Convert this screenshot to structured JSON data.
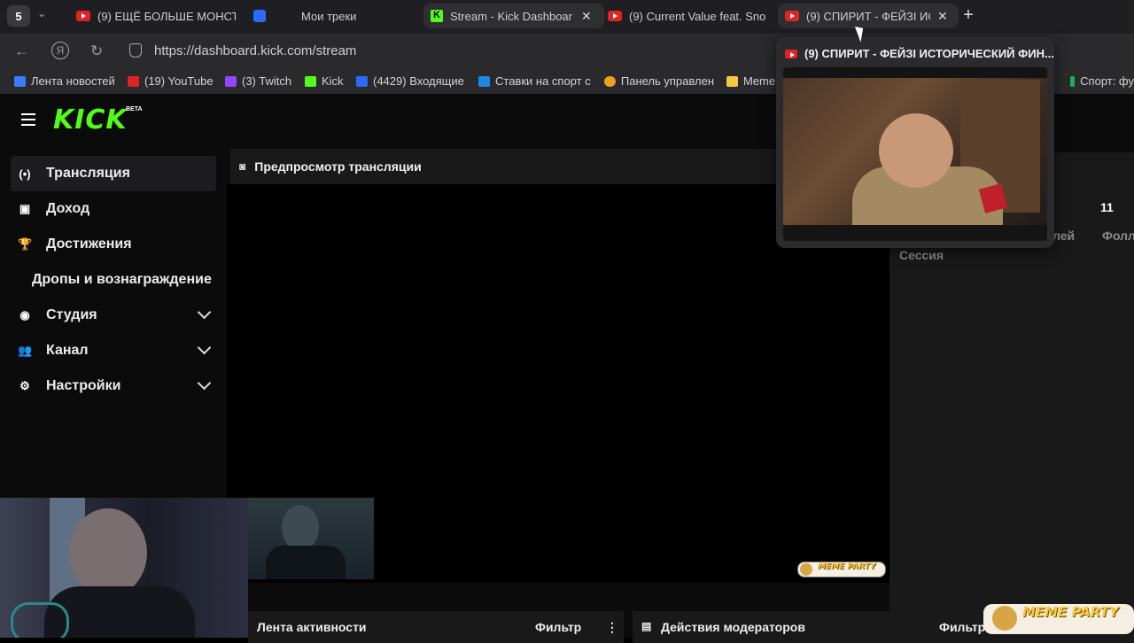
{
  "browser": {
    "tabs_count": "5",
    "tabs": [
      {
        "label": "(9) ЕЩЁ БОЛЬШЕ МОНСТ",
        "icon": "youtube-icon"
      },
      {
        "label": "Мои треки",
        "icon": "music-icon"
      },
      {
        "label": "Stream - Kick Dashboar",
        "icon": "kick-icon"
      },
      {
        "label": "(9) Current Value feat. Sno",
        "icon": "youtube-icon"
      },
      {
        "label": "(9) СПИРИТ - ФЕЙЗІ ИС",
        "icon": "youtube-icon"
      }
    ],
    "url": "https://dashboard.kick.com/stream",
    "bookmarks": [
      {
        "label": "Лента новостей"
      },
      {
        "label": "(19) YouTube"
      },
      {
        "label": "(3) Twitch"
      },
      {
        "label": "Kick"
      },
      {
        "label": "(4429) Входящие"
      },
      {
        "label": "Ставки на спорт с"
      },
      {
        "label": "Панель управлен"
      },
      {
        "label": "Meme"
      },
      {
        "label": "Спорт: фу"
      }
    ],
    "hover_preview_title": "(9) СПИРИТ - ФЕЙЗІ ИСТОРИЧЕСКИЙ ФИН..."
  },
  "kick": {
    "logo": "KICK",
    "beta": "BETA",
    "sidebar": [
      {
        "label": "Трансляция",
        "icon": "broadcast-icon"
      },
      {
        "label": "Доход",
        "icon": "chart-icon"
      },
      {
        "label": "Достижения",
        "icon": "trophy-icon"
      },
      {
        "label": "Дропы и вознаграждение"
      },
      {
        "label": "Студия",
        "icon": "studio-icon"
      },
      {
        "label": "Канал",
        "icon": "users-icon"
      },
      {
        "label": "Настройки",
        "icon": "gear-icon"
      }
    ],
    "preview_title": "Предпросмотр трансляции",
    "stats": {
      "value": "11",
      "label1": "лей",
      "label2": "Фолл",
      "session": "Сессия"
    },
    "activity_title": "Лента активности",
    "activity_filter": "Фильтр",
    "moderators_title": "Действия модераторов",
    "moderators_filter": "Фильтр"
  },
  "overlays": {
    "meme_party": "MEME PARTY"
  }
}
